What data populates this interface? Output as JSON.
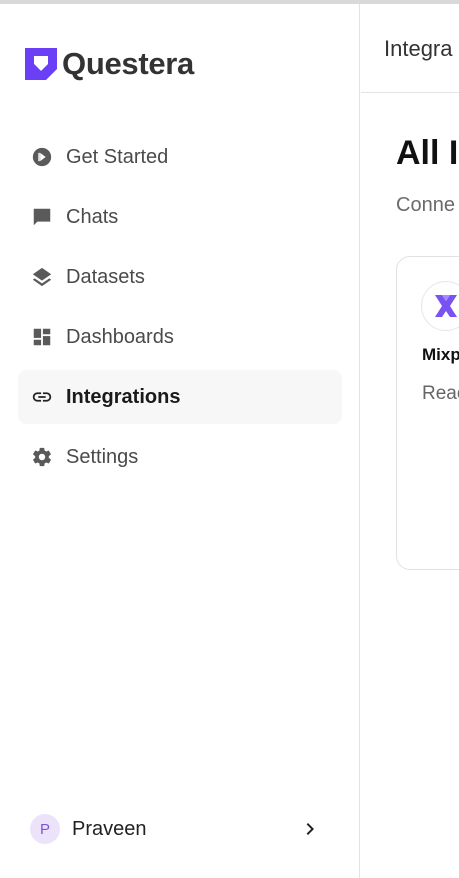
{
  "brand": {
    "name": "Questera",
    "accent": "#6b3ff5"
  },
  "sidebar": {
    "items": [
      {
        "label": "Get Started",
        "icon": "play-circle-icon",
        "active": false
      },
      {
        "label": "Chats",
        "icon": "chat-bubble-icon",
        "active": false
      },
      {
        "label": "Datasets",
        "icon": "layers-icon",
        "active": false
      },
      {
        "label": "Dashboards",
        "icon": "dashboard-grid-icon",
        "active": false
      },
      {
        "label": "Integrations",
        "icon": "link-icon",
        "active": true
      },
      {
        "label": "Settings",
        "icon": "gear-icon",
        "active": false
      }
    ],
    "user": {
      "initial": "P",
      "name": "Praveen",
      "menu_icon": "chevron-right-icon"
    }
  },
  "main": {
    "header_title": "Integra",
    "page_title": "All I",
    "page_subtitle": "Conne",
    "cards": [
      {
        "name": "Mixp",
        "description": "Reac user",
        "icon": "mixpanel-logo-icon"
      }
    ]
  }
}
